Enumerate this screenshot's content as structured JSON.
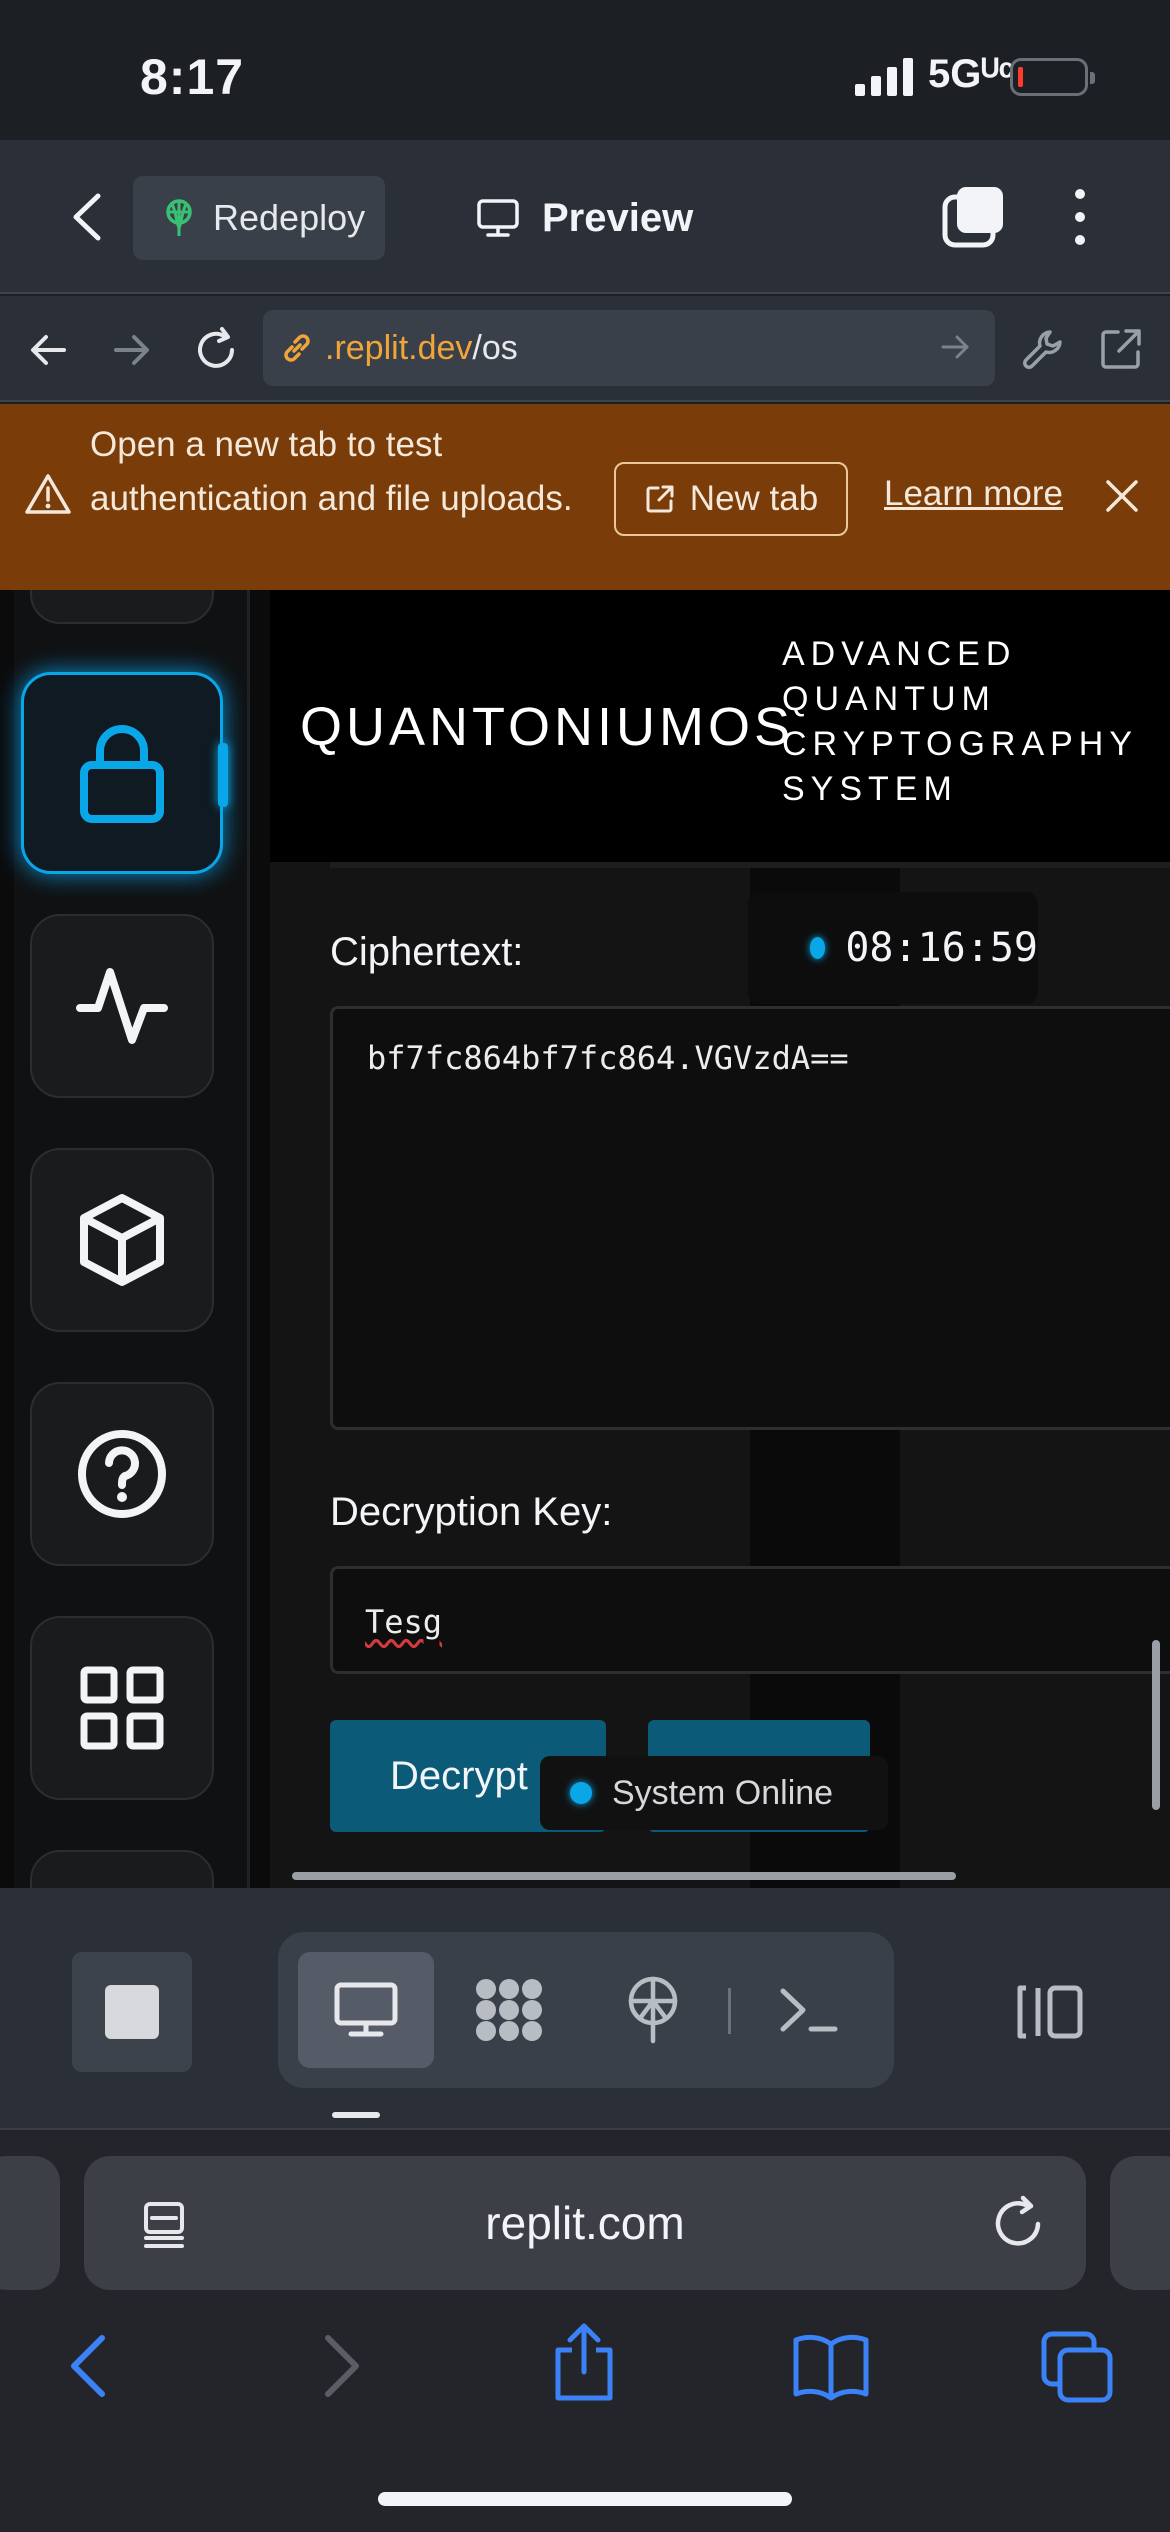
{
  "status_bar": {
    "time": "8:17",
    "network": "5Gᵁᶜ"
  },
  "app_header": {
    "redeploy_label": "Redeploy",
    "preview_label": "Preview"
  },
  "url_bar": {
    "host": ".replit.dev",
    "path": "/os"
  },
  "banner": {
    "message": "Open a new tab to test authentication and file uploads.",
    "new_tab_label": "New tab",
    "learn_more_label": "Learn more"
  },
  "app": {
    "title": "QUANTONIUMOS",
    "subtitle": "ADVANCED QUANTUM CRYPTOGRAPHY SYSTEM",
    "clock": "08:16:59",
    "ciphertext_label": "Ciphertext:",
    "ciphertext_value": "bf7fc864bf7fc864.VGVzdA==",
    "key_label": "Decryption Key:",
    "key_value": "Tesg",
    "decrypt_button": "Decrypt",
    "system_status": "System Online",
    "accent_color": "#0aa7e8",
    "sidebar_icons": [
      "lock-icon",
      "activity-icon",
      "cube-icon",
      "help-icon",
      "grid-icon"
    ]
  },
  "safari": {
    "address": "replit.com"
  }
}
